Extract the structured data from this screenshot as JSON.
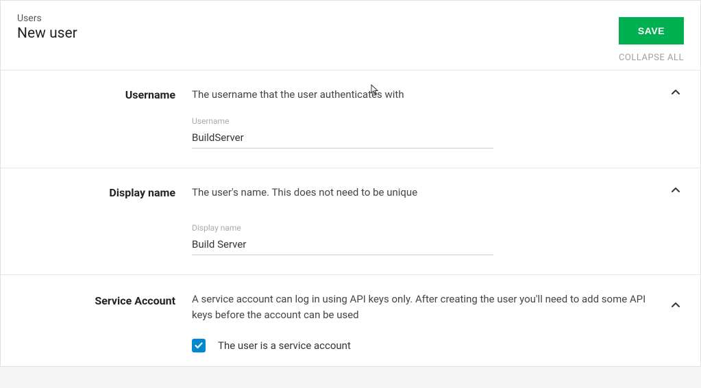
{
  "header": {
    "breadcrumb": "Users",
    "title": "New user",
    "save_label": "SAVE",
    "collapse_all_label": "COLLAPSE ALL"
  },
  "sections": {
    "username": {
      "label": "Username",
      "description": "The username that the user authenticates with",
      "field_label": "Username",
      "value": "BuildServer"
    },
    "display_name": {
      "label": "Display name",
      "description": "The user's name. This does not need to be unique",
      "field_label": "Display name",
      "value": "Build Server"
    },
    "service_account": {
      "label": "Service Account",
      "description": "A service account can log in using API keys only. After creating the user you'll need to add some API keys before the account can be used",
      "checkbox_label": "The user is a service account",
      "checked": true
    }
  }
}
